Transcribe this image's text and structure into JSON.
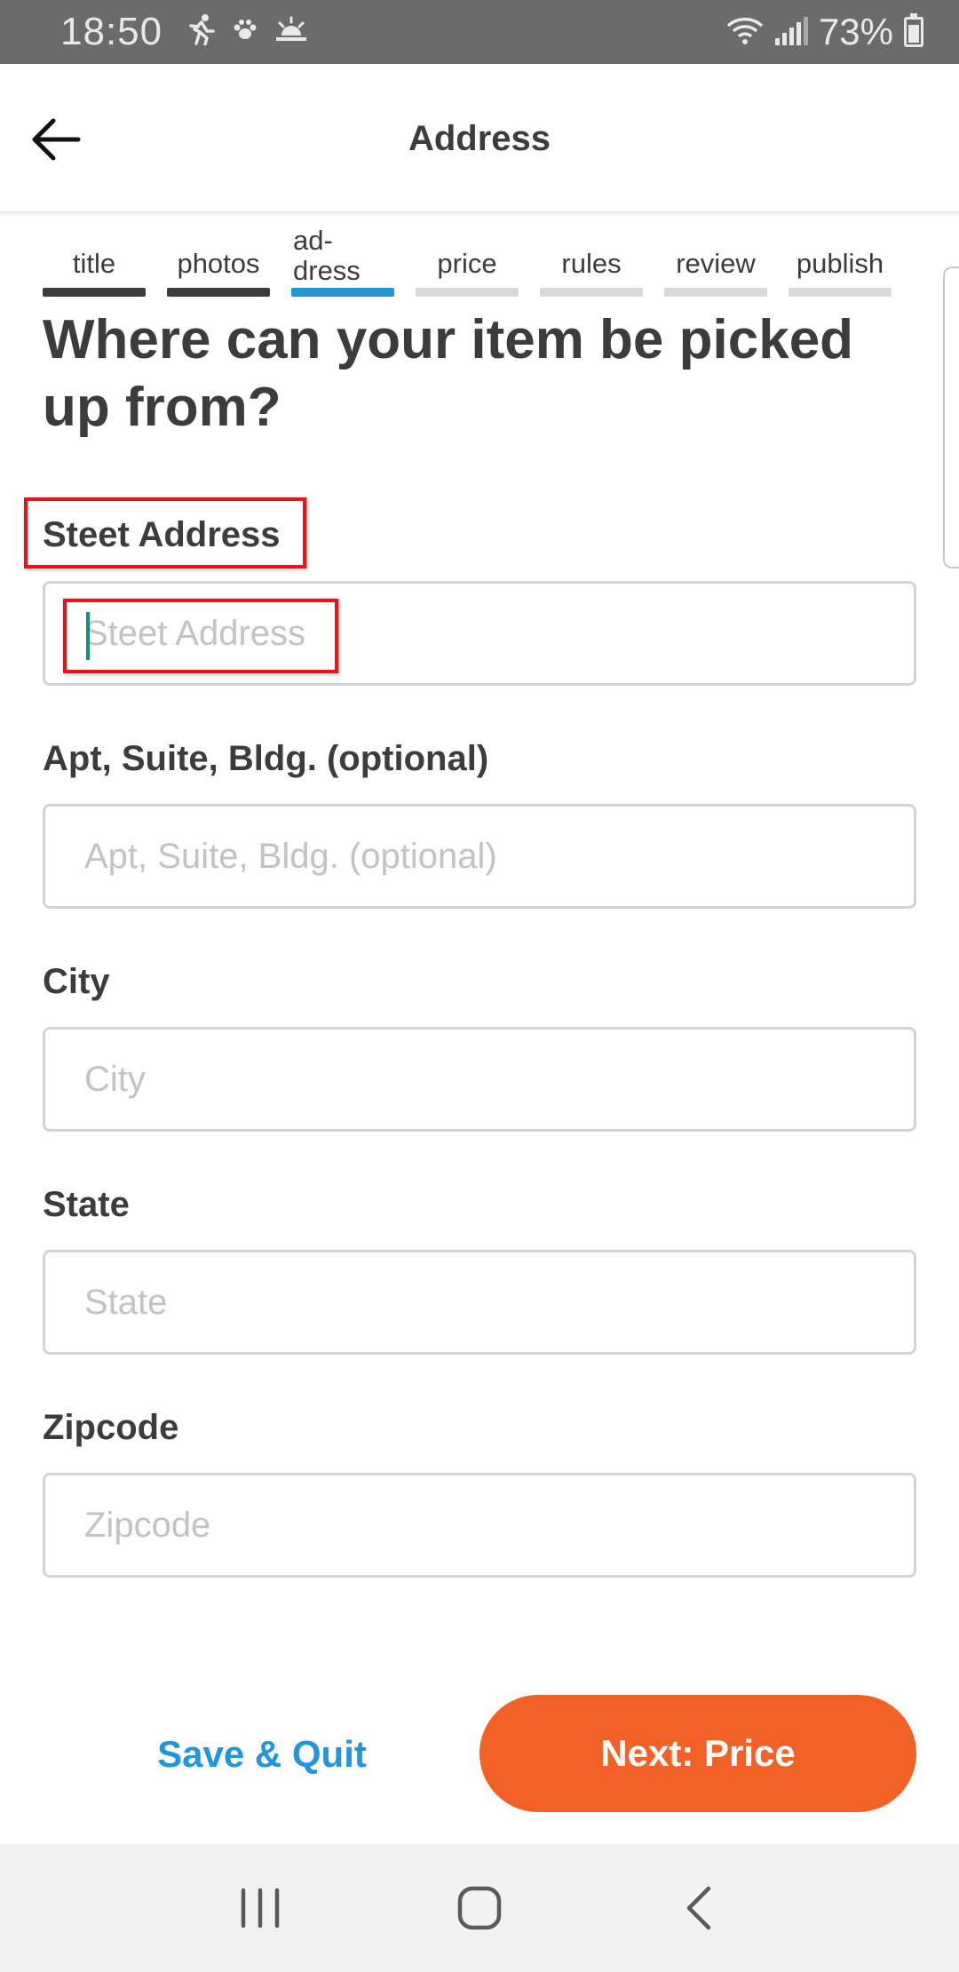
{
  "status_bar": {
    "time": "18:50",
    "battery": "73%",
    "icons": [
      "running-icon",
      "paw-icon",
      "sunrise-icon",
      "wifi-icon",
      "signal-icon",
      "battery-icon"
    ]
  },
  "app_bar": {
    "title": "Address",
    "back_icon": "arrow-left-icon"
  },
  "stepper": {
    "steps": [
      {
        "label": "title",
        "state": "done"
      },
      {
        "label": "photos",
        "state": "done"
      },
      {
        "label": "ad-\ndress",
        "state": "active"
      },
      {
        "label": "price",
        "state": "todo"
      },
      {
        "label": "rules",
        "state": "todo"
      },
      {
        "label": "review",
        "state": "todo"
      },
      {
        "label": "publish",
        "state": "todo"
      }
    ]
  },
  "heading": "Where can your item be picked up from?",
  "form": {
    "street": {
      "label": "Steet Address",
      "placeholder": "Steet Address",
      "value": ""
    },
    "apt": {
      "label": "Apt, Suite, Bldg. (optional)",
      "placeholder": "Apt, Suite, Bldg. (optional)",
      "value": ""
    },
    "city": {
      "label": "City",
      "placeholder": "City",
      "value": ""
    },
    "state": {
      "label": "State",
      "placeholder": "State",
      "value": ""
    },
    "zip": {
      "label": "Zipcode",
      "placeholder": "Zipcode",
      "value": ""
    }
  },
  "actions": {
    "save_quit": "Save & Quit",
    "next": "Next: Price"
  },
  "colors": {
    "accent_orange": "#f26126",
    "link_blue": "#2196d8",
    "step_done": "#3c3c3c",
    "step_todo": "#d9d9d9",
    "highlight_red": "#e5141a"
  },
  "nav_bar": {
    "buttons": [
      "recent-apps-icon",
      "home-icon",
      "back-icon"
    ]
  }
}
